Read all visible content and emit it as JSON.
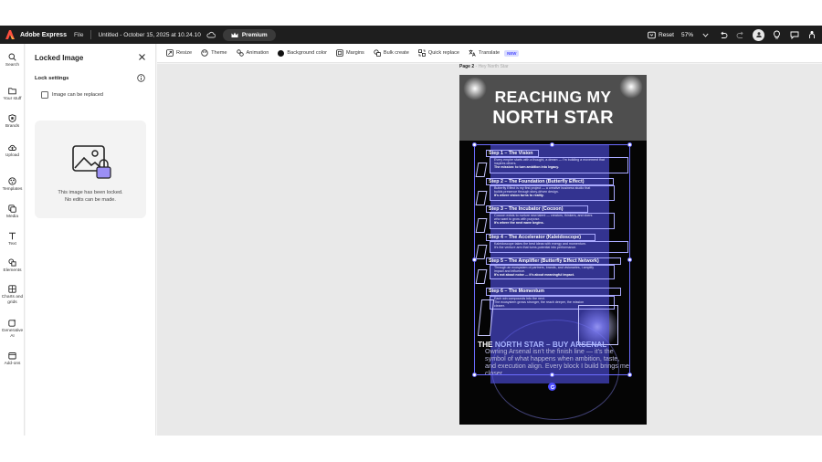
{
  "app": {
    "name": "Adobe Express",
    "file_menu": "File",
    "document_title": "Untitled - October 15, 2025 at 10.24.10",
    "premium_label": "Premium",
    "reset_label": "Reset",
    "zoom": "57%"
  },
  "rail": [
    {
      "label": "Search"
    },
    {
      "label": "Your stuff"
    },
    {
      "label": "Brands"
    },
    {
      "label": "Upload"
    },
    {
      "label": "Templates"
    },
    {
      "label": "Media"
    },
    {
      "label": "Text"
    },
    {
      "label": "Elements"
    },
    {
      "label": "Charts and grids"
    },
    {
      "label": "Generative AI"
    },
    {
      "label": "Add-ons"
    }
  ],
  "panel": {
    "title": "Locked Image",
    "lock_settings": "Lock settings",
    "checkbox_label": "Image can be replaced",
    "checkbox_checked": false,
    "locked_message_1": "This image has been locked.",
    "locked_message_2": "No edits can be made."
  },
  "toolbar": [
    {
      "label": "Resize"
    },
    {
      "label": "Theme"
    },
    {
      "label": "Animation"
    },
    {
      "label": "Background color"
    },
    {
      "label": "Margins"
    },
    {
      "label": "Bulk create"
    },
    {
      "label": "Quick replace"
    },
    {
      "label": "Translate",
      "badge": "NEW"
    }
  ],
  "canvas": {
    "page_label": "Page 2",
    "page_sub": " - Hey North Star",
    "header_line1": "REACHING MY",
    "header_line2": "NORTH STAR",
    "steps": [
      {
        "title": "Step 1 – The Vision",
        "lines": [
          "Every empire starts with a thought, a dream — I'm building a movement that",
          "inspires others.",
          "The mission: to turn ambition into legacy."
        ]
      },
      {
        "title": "Step 2 – The Foundation (Butterfly Effect)",
        "lines": [
          "Butterfly Effect is my first project — a creative business studio that",
          "builds presence through story-driven design.",
          "It's where vision turns to reality."
        ]
      },
      {
        "title": "Step 3 – The Incubator (Cocoon)",
        "lines": [
          "Cocoon exists to nurture new talent — creators, thinkers, and doers",
          "who want to grow with purpose.",
          "It's where the next wave begins."
        ]
      },
      {
        "title": "Step 4 – The Accelerator (Kaleidoscope)",
        "lines": [
          "Kaleidoscope takes the best ideas with energy and momentum.",
          "It's the venture arm that turns potential into performance."
        ]
      },
      {
        "title": "Step 5 – The Amplifier (Butterfly Effect Network)",
        "lines": [
          "Through an ecosystem of partners, brands, and visionaries, I amplify",
          "impact and influence.",
          "It's not about noise — it's about meaningful impact."
        ]
      },
      {
        "title": "Step 6 – The Momentum",
        "lines": [
          "Each win compounds into the next.",
          "The ecosystem grows stronger, the reach deeper, the mission",
          "clearer."
        ]
      }
    ],
    "north_title_a": "THE ",
    "north_title_b": "NORTH STAR – BUY ARSENAL",
    "north_body": "Owning Arsenal isn't the finish line — it's the symbol of what happens when ambition, taste, and execution align. Every block I build brings me closer."
  },
  "colors": {
    "topbar": "#1e1e1e",
    "accent": "#6c6cff",
    "selection_fill": "#5050e6",
    "header_bg": "#4e4e4e"
  },
  "icons": [
    "adobe-logo-icon",
    "cloud-icon",
    "crown-icon",
    "history-icon",
    "chevron-down-icon",
    "undo-icon",
    "redo-icon",
    "user-icon",
    "lightbulb-icon",
    "comment-icon",
    "share-icon",
    "search-icon",
    "folder-icon",
    "brand-icon",
    "upload-icon",
    "templates-icon",
    "media-icon",
    "text-icon",
    "elements-icon",
    "grid-icon",
    "sparkle-icon",
    "addons-icon",
    "close-icon",
    "info-icon",
    "image-locked-icon",
    "resize-icon",
    "theme-icon",
    "animation-icon",
    "margins-icon",
    "bulk-create-icon",
    "quick-replace-icon",
    "translate-icon",
    "rotate-icon"
  ]
}
